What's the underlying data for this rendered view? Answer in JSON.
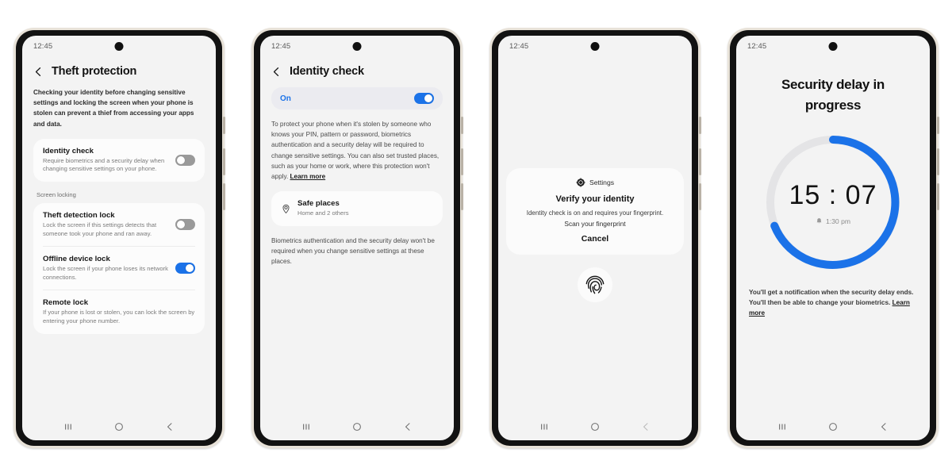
{
  "phones": [
    {
      "id": "theft-protection",
      "status_time": "12:45",
      "header_title": "Theft protection",
      "intro": "Checking your identity before changing sensitive settings and locking the screen when your phone is stolen can prevent a thief from accessing your apps and data.",
      "items": [
        {
          "title": "Identity check",
          "subtitle": "Require biometrics and a security delay when changing sensitive settings on your phone.",
          "toggle": "off"
        }
      ],
      "section_label": "Screen locking",
      "screen_locking_items": [
        {
          "title": "Theft detection lock",
          "subtitle": "Lock the screen if this settings detects that someone took your phone and ran away.",
          "toggle": "off"
        },
        {
          "title": "Offline device lock",
          "subtitle": "Lock the screen if your phone loses its network connections.",
          "toggle": "on"
        },
        {
          "title": "Remote lock",
          "subtitle": "If your phone is lost or stolen, you can lock the screen by entering your phone number.",
          "toggle": "none"
        }
      ]
    },
    {
      "id": "identity-check",
      "status_time": "12:45",
      "header_title": "Identity check",
      "on_label": "On",
      "on_toggle": "on",
      "body": "To protect your phone when it's stolen by someone who knows your PIN, pattern or password, biometrics authentication and a security delay will be required to change sensitive settings. You can also set trusted places, such as your home or work, where this protection won't apply.",
      "body_link": "Learn more",
      "safe_places": {
        "title": "Safe places",
        "subtitle": "Home and 2 others",
        "icon": "location-pin-icon"
      },
      "footer": "Biometrics authentication and the security delay won't be required when you change sensitive settings at these places."
    },
    {
      "id": "verify-identity",
      "status_time": "12:45",
      "app_name": "Settings",
      "app_icon": "settings-gear-icon",
      "sheet_title": "Verify your identity",
      "sheet_desc": "Identity check is on and requires your fingerprint.",
      "sheet_scan": "Scan your fingerprint",
      "cancel_label": "Cancel",
      "fingerprint_icon": "fingerprint-icon"
    },
    {
      "id": "security-delay",
      "status_time": "12:45",
      "title": "Security delay in progress",
      "timer": "15 : 07",
      "alarm_time": "1:30 pm",
      "alarm_icon": "alarm-bell-icon",
      "footnote": "You'll get a notification when the security delay ends. You'll then be able to change your biometrics.",
      "footnote_link": "Learn more",
      "ring": {
        "progress_percent": 81,
        "track_color": "#e4e4e6",
        "progress_color": "#1b72e8"
      }
    }
  ],
  "navbar": {
    "recents_label": "recent-apps",
    "home_label": "home",
    "back_label": "back"
  },
  "colors": {
    "accent_blue": "#1b72e8",
    "screen_bg": "#f3f3f3",
    "card_bg": "#fcfcfc",
    "frame": "#121212",
    "frame_edge": "#e8e2d8"
  }
}
